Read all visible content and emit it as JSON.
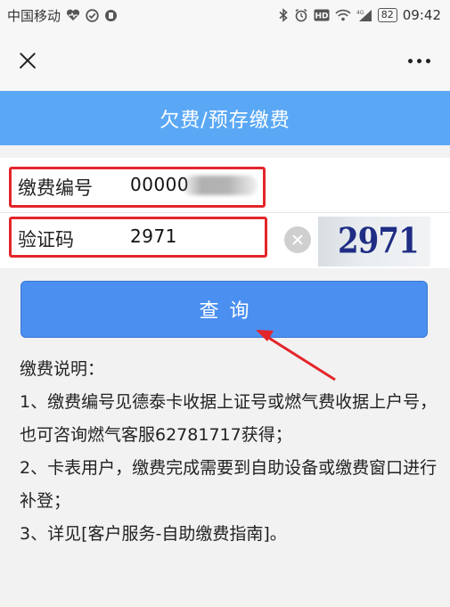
{
  "statusbar": {
    "carrier": "中国移动",
    "battery": "82",
    "time": "09:42",
    "left_icons": [
      "heart-rate-icon",
      "check-circle-icon",
      "paw-icon"
    ],
    "right_icons": [
      "bluetooth-icon",
      "alarm-icon",
      "hd-icon",
      "wifi-icon",
      "signal-icon"
    ]
  },
  "navbar": {
    "close_icon": "close-icon",
    "more_icon": "more-icon"
  },
  "page_title": "欠费/预存缴费",
  "form": {
    "account_label": "缴费编号",
    "account_value": "00000",
    "captcha_label": "验证码",
    "captcha_value": "2971",
    "captcha_image_text": "2971"
  },
  "query_button": "查询",
  "description": {
    "heading": "缴费说明：",
    "items": [
      "1、缴费编号见德泰卡收据上证号或燃气费收据上户号，也可咨询燃气客服62781717获得；",
      "2、卡表用户，缴费完成需要到自助设备或缴费窗口进行补登；",
      "3、详见[客户服务-自助缴费指南]。"
    ]
  },
  "colors": {
    "title_bar": "#5aa8f5",
    "button": "#4b8ff0",
    "highlight": "#e3262b"
  }
}
